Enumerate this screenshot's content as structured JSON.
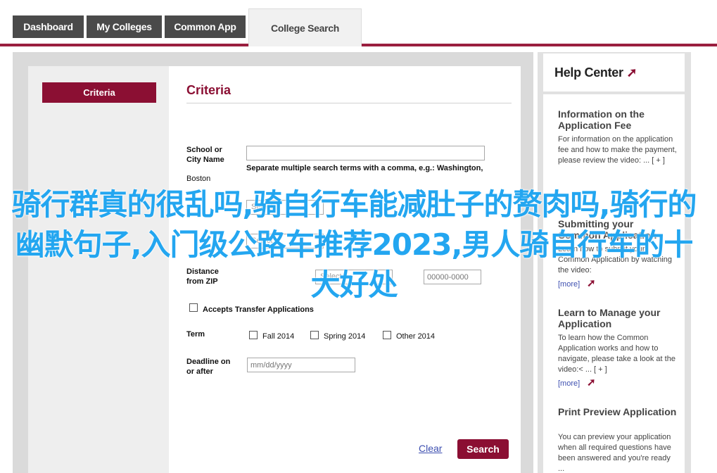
{
  "tabs": [
    {
      "label": "Dashboard"
    },
    {
      "label": "My Colleges"
    },
    {
      "label": "Common App"
    },
    {
      "label": "College Search"
    }
  ],
  "nav": {
    "criteria_button": "Criteria"
  },
  "main": {
    "title": "Criteria",
    "school_label": "School or\nCity Name",
    "school_help": "Separate multiple search terms with a comma, e.g.: Washington,",
    "school_hint": "Boston",
    "select_placeholder_1": "Select",
    "select_placeholder_2": "Select",
    "distance_label": "Distance\nfrom ZIP",
    "zip_placeholder": "00000-0000",
    "transfer_label": "Accepts Transfer Applications",
    "term_label": "Term",
    "term_options": [
      "Fall 2014",
      "Spring 2014",
      "Other 2014"
    ],
    "deadline_label": "Deadline on\nor after",
    "deadline_placeholder": "mm/dd/yyyy",
    "clear": "Clear",
    "search": "Search"
  },
  "watermark": "骑行群真的很乱吗,骑自行车能减肚子的赘肉吗,骑行的幽默句子,入门级公路车推荐2023,男人骑自行车的十大好处",
  "help": {
    "title": "Help Center",
    "more": "[more]",
    "items": [
      {
        "title": "Information on the Application Fee",
        "desc": "For information on the application fee and how to make the payment, please review the video: ... [ + ]"
      },
      {
        "title": "Submitting your Common Application",
        "desc": "Learn how to submit your Common Application by watching the video:"
      },
      {
        "title": "Learn to Manage your Application",
        "desc": "To learn how the Common Application works and how to navigate, please take a look at the video:< ... [ + ]"
      },
      {
        "title": "Print Preview Application",
        "desc": "You can preview your application when all required questions have been answered and you're ready ..."
      }
    ]
  },
  "colors": {
    "brand": "#8b0f33",
    "tab_bg": "#4a4a4a",
    "link": "#3d4fb0",
    "watermark": "#23a6f0"
  },
  "icons": {
    "more_arrow": "arrow-icon"
  }
}
